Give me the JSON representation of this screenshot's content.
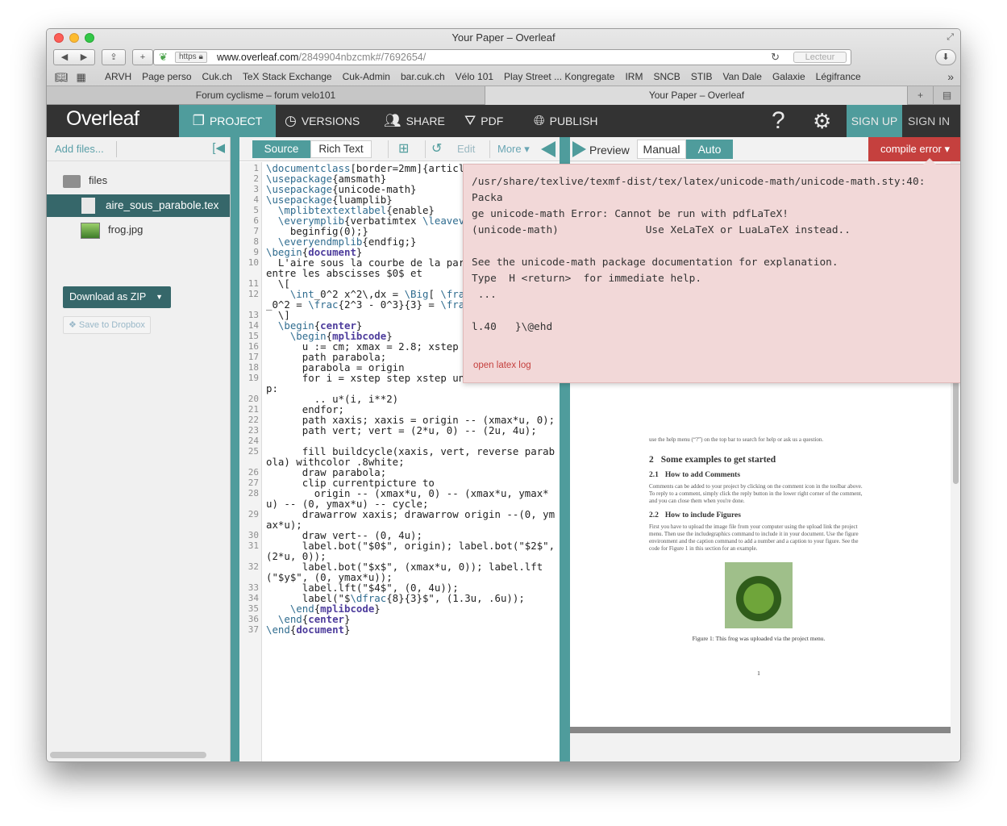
{
  "browser": {
    "window_title": "Your Paper – Overleaf",
    "url_scheme": "https",
    "url_host": "www.overleaf.com",
    "url_path": "/2849904nbzcmk#/7692654/",
    "reader_label": "Lecteur",
    "bookmarks": [
      "ARVH",
      "Page perso",
      "Cuk.ch",
      "TeX Stack Exchange",
      "Cuk-Admin",
      "bar.cuk.ch",
      "Vélo 101",
      "Play Street ... Kongregate",
      "IRM",
      "SNCB",
      "STIB",
      "Van Dale",
      "Galaxie",
      "Légifrance"
    ],
    "tabs": [
      "Forum cyclisme – forum velo101",
      "Your Paper – Overleaf"
    ]
  },
  "nav": {
    "logo": "Overleaf",
    "project": "PROJECT",
    "versions": "VERSIONS",
    "share": "SHARE",
    "pdf": "PDF",
    "publish": "PUBLISH",
    "help": "?",
    "signup": "SIGN UP",
    "signin": "SIGN IN"
  },
  "filetree": {
    "add_files": "Add files...",
    "folder": "files",
    "files": [
      "aire_sous_parabole.tex",
      "frog.jpg"
    ],
    "download": "Download as ZIP",
    "dropbox": "Save to Dropbox"
  },
  "editor": {
    "source": "Source",
    "rich_text": "Rich Text",
    "edit": "Edit",
    "more": "More",
    "lines": [
      {
        "n": "1",
        "t": "\\documentclass[border=2mm]{article}"
      },
      {
        "n": "2",
        "t": "\\usepackage{amsmath}"
      },
      {
        "n": "3",
        "t": "\\usepackage{unicode-math}"
      },
      {
        "n": "4",
        "t": "\\usepackage{luamplib}"
      },
      {
        "n": "5",
        "t": "  \\mplibtextextlabel{enable}"
      },
      {
        "n": "6",
        "t": "  \\everymplib{verbatimtex \\leavevmode"
      },
      {
        "n": "7",
        "t": "    beginfig(0);}"
      },
      {
        "n": "8",
        "t": "  \\everyendmplib{endfig;}"
      },
      {
        "n": "9",
        "t": "\\begin{document}"
      },
      {
        "n": "10",
        "t": "  L'aire sous la courbe de la parabole $y = x^2$ entre les abscisses $0$ et"
      },
      {
        "n": "11",
        "t": "  \\["
      },
      {
        "n": "12",
        "t": "    \\int_0^2 x^2\\,dx = \\Big[ \\frac{x^3}{3} \\Big]_0^2 = \\frac{2^3 - 0^3}{3} = \\frac{8}{3}."
      },
      {
        "n": "13",
        "t": "  \\]"
      },
      {
        "n": "14",
        "t": "  \\begin{center}"
      },
      {
        "n": "15",
        "t": "    \\begin{mplibcode}"
      },
      {
        "n": "16",
        "t": "      u := cm; xmax = 2.8; xstep = xmax/256;"
      },
      {
        "n": "17",
        "t": "      path parabola;"
      },
      {
        "n": "18",
        "t": "      parabola = origin"
      },
      {
        "n": "19",
        "t": "      for i = xstep step xstep until xmax+.5xstep:"
      },
      {
        "n": "20",
        "t": "        .. u*(i, i**2)"
      },
      {
        "n": "21",
        "t": "      endfor;"
      },
      {
        "n": "22",
        "t": "      path xaxis; xaxis = origin -- (xmax*u, 0);"
      },
      {
        "n": "23",
        "t": "      path vert; vert = (2*u, 0) -- (2u, 4u);"
      },
      {
        "n": "24",
        "t": ""
      },
      {
        "n": "25",
        "t": "      fill buildcycle(xaxis, vert, reverse parabola) withcolor .8white;"
      },
      {
        "n": "26",
        "t": "      draw parabola;"
      },
      {
        "n": "27",
        "t": "      clip currentpicture to"
      },
      {
        "n": "28",
        "t": "        origin -- (xmax*u, 0) -- (xmax*u, ymax*u) -- (0, ymax*u) -- cycle;"
      },
      {
        "n": "29",
        "t": "      drawarrow xaxis; drawarrow origin --(0, ymax*u);"
      },
      {
        "n": "30",
        "t": "      draw vert-- (0, 4u);"
      },
      {
        "n": "31",
        "t": "      label.bot(\"$0$\", origin); label.bot(\"$2$\", (2*u, 0));"
      },
      {
        "n": "32",
        "t": "      label.bot(\"$x$\", (xmax*u, 0)); label.lft(\"$y$\", (0, ymax*u));"
      },
      {
        "n": "33",
        "t": "      label.lft(\"$4$\", (0, 4u));"
      },
      {
        "n": "34",
        "t": "      label(\"$\\dfrac{8}{3}$\", (1.3u, .6u));"
      },
      {
        "n": "35",
        "t": "    \\end{mplibcode}"
      },
      {
        "n": "36",
        "t": "  \\end{center}"
      },
      {
        "n": "37",
        "t": "\\end{document}"
      }
    ]
  },
  "preview": {
    "preview_label": "Preview",
    "manual": "Manual",
    "auto": "Auto",
    "compile_error": "compile error",
    "paper": {
      "intro_tail": "use the help menu (“?”) on the top bar to search for help or ask us a question.",
      "section_num": "2",
      "section_title": "Some examples to get started",
      "sub1_num": "2.1",
      "sub1_title": "How to add Comments",
      "sub1_text": "Comments can be added to your project by clicking on the comment icon in the toolbar above. To reply to a comment, simply click the reply button in the lower right corner of the comment, and you can close them when you're done.",
      "sub2_num": "2.2",
      "sub2_title": "How to include Figures",
      "sub2_text": "First you have to upload the image file from your computer using the upload link the project menu. Then use the includegraphics command to include it in your document. Use the figure environment and the caption command to add a number and a caption to your figure. See the code for Figure 1 in this section for an example.",
      "caption": "Figure 1: This frog was uploaded via the project menu.",
      "page_number": "1"
    }
  },
  "error": {
    "log": "/usr/share/texlive/texmf-dist/tex/latex/unicode-math/unicode-math.sty:40:\nPacka\nge unicode-math Error: Cannot be run with pdfLaTeX!\n(unicode-math)              Use XeLaTeX or LuaLaTeX instead..\n\nSee the unicode-math package documentation for explanation.\nType  H <return>  for immediate help.\n ...\n\nl.40   }\\@ehd",
    "open_log": "open latex log"
  },
  "colors": {
    "teal": "#4f9c9c",
    "dark_teal": "#36676a",
    "navbar": "#333333",
    "error_red": "#c5403e",
    "error_bg": "#f2d8d8"
  }
}
